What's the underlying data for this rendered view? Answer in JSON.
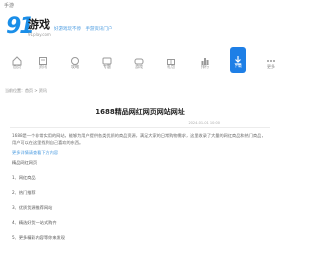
{
  "topbar": {
    "back_label": "手游"
  },
  "header": {
    "logo_number": "91",
    "logo_text": "游戏",
    "logo_sub": "91play.com",
    "tagline": [
      "好游戏玩不停",
      "手游资讯门户"
    ]
  },
  "nav": [
    {
      "label": "首页",
      "icon": "home-icon"
    },
    {
      "label": "资讯",
      "icon": "news-icon"
    },
    {
      "label": "攻略",
      "icon": "guide-icon"
    },
    {
      "label": "专题",
      "icon": "topic-icon"
    },
    {
      "label": "游戏",
      "icon": "game-icon"
    },
    {
      "label": "礼包",
      "icon": "gift-icon"
    },
    {
      "label": "排行",
      "icon": "rank-icon"
    },
    {
      "label": "下载",
      "icon": "download-icon",
      "active": true
    },
    {
      "label": "更多",
      "icon": "more-icon"
    }
  ],
  "breadcrumb": "当前位置：首页 > 资讯",
  "article": {
    "title": "1688精品网红网页网站网址",
    "meta": "2024-01-01 10:00",
    "lead": "1688是一个非常实用的网站，能够为用户提供各类优质的商品资源，满足大家的日常购物需求，这里收录了大量的网红商品和热门商品，用户可以在这里找到自己喜欢的东西。",
    "link_text": "更多详情请查看下方内容",
    "items": [
      "精品网红网页",
      "1、网红商品",
      "2、热门推荐",
      "3、优质货源推荐网站",
      "4、精选好货一站式购齐",
      "5、更多精彩内容等你来发现"
    ]
  }
}
